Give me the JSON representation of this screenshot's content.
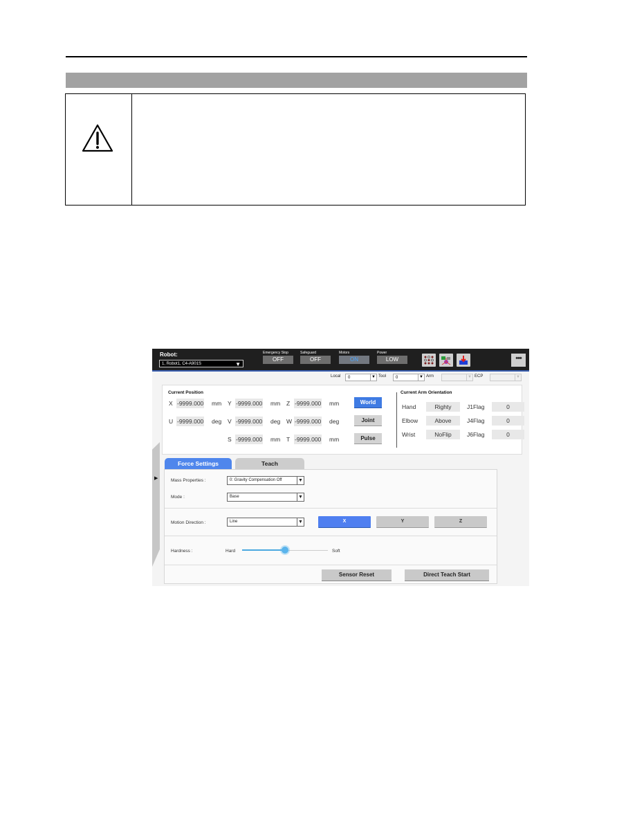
{
  "document": {
    "caution_icon": "warning-triangle-icon"
  },
  "app": {
    "robot_label": "Robot:",
    "robot_selected": "1, Robot1, C4-A901S",
    "status": [
      {
        "label": "Emergency Stop",
        "value": "OFF"
      },
      {
        "label": "Safeguard",
        "value": "OFF"
      },
      {
        "label": "Motors",
        "value": "ON"
      },
      {
        "label": "Power",
        "value": "LOW"
      }
    ],
    "toolbar_icons": [
      "io-monitor-icon",
      "robot-axes-icon",
      "jog-teach-icon"
    ],
    "more_label": "•••",
    "local_label": "Local",
    "local_value": "0",
    "tool_label": "Tool",
    "tool_value": "0",
    "arm_label": "Arm",
    "arm_value": "",
    "ecp_label": "ECP",
    "ecp_value": "",
    "current_position": {
      "title": "Current Position",
      "rows": [
        [
          {
            "axis": "X",
            "value": "-9999.000",
            "unit": "mm"
          },
          {
            "axis": "Y",
            "value": "-9999.000",
            "unit": "mm"
          },
          {
            "axis": "Z",
            "value": "-9999.000",
            "unit": "mm"
          }
        ],
        [
          {
            "axis": "U",
            "value": "-9999.000",
            "unit": "deg"
          },
          {
            "axis": "V",
            "value": "-9999.000",
            "unit": "deg"
          },
          {
            "axis": "W",
            "value": "-9999.000",
            "unit": "deg"
          }
        ],
        [
          {
            "axis": "S",
            "value": "-9999.000",
            "unit": "mm"
          },
          {
            "axis": "T",
            "value": "-9999.000",
            "unit": "mm"
          }
        ]
      ],
      "modes": [
        "World",
        "Joint",
        "Pulse"
      ],
      "active_mode": "World"
    },
    "arm_orientation": {
      "title": "Current Arm Orientation",
      "rows": [
        {
          "label": "Hand",
          "value": "Righty",
          "flag_label": "J1Flag",
          "flag_value": "0"
        },
        {
          "label": "Elbow",
          "value": "Above",
          "flag_label": "J4Flag",
          "flag_value": "0"
        },
        {
          "label": "Wrist",
          "value": "NoFlip",
          "flag_label": "J6Flag",
          "flag_value": "0"
        }
      ]
    },
    "tabs": [
      "Force Settings",
      "Teach"
    ],
    "active_tab": "Force Settings",
    "force": {
      "mass_label": "Mass Properties :",
      "mass_value": "0: Gravity Compensation Off",
      "mode_label": "Mode :",
      "mode_value": "Base",
      "motion_label": "Motion Direction :",
      "motion_value": "Line",
      "directions": [
        "X",
        "Y",
        "Z"
      ],
      "active_direction": "X",
      "hardness_label": "Hardness :",
      "hard_label": "Hard",
      "soft_label": "Soft",
      "hardness_fraction": 0.5,
      "sensor_reset": "Sensor Reset",
      "direct_teach_start": "Direct Teach Start"
    }
  }
}
